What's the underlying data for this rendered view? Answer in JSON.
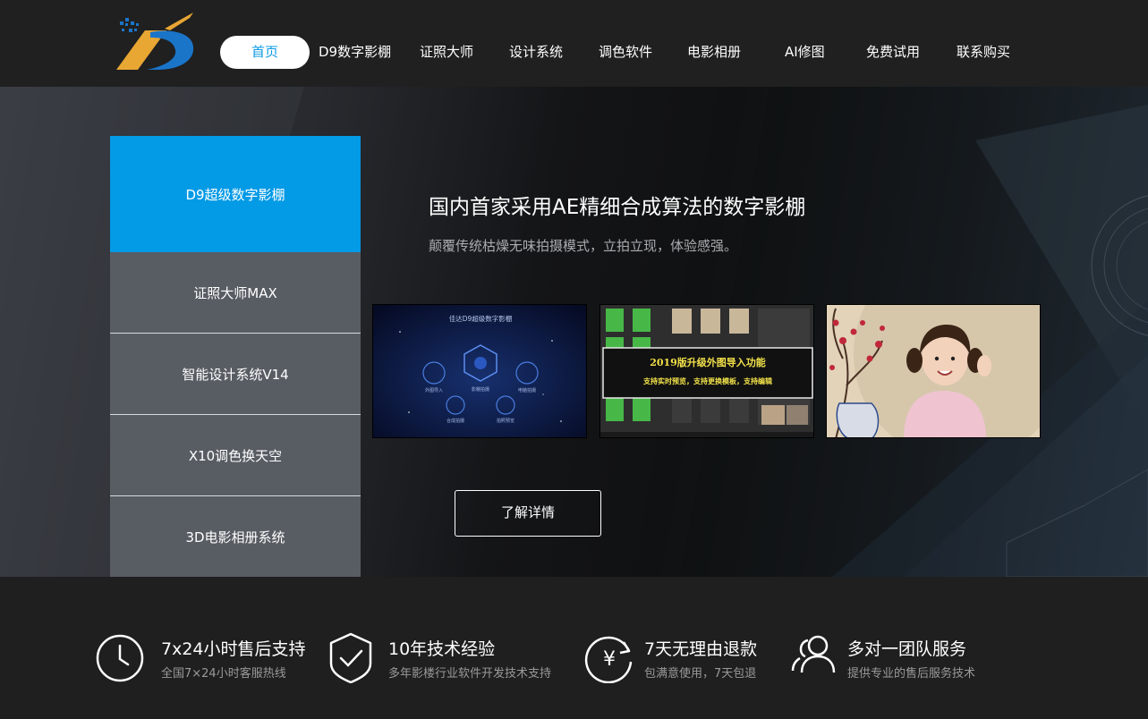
{
  "nav": {
    "items": [
      "首页",
      "D9数字影棚",
      "证照大师",
      "设计系统",
      "调色软件",
      "电影相册",
      "AI修图",
      "免费试用",
      "联系购买"
    ],
    "active_index": 0
  },
  "sidebar": {
    "items": [
      "D9超级数字影棚",
      "证照大师MAX",
      "智能设计系统V14",
      "X10调色换天空",
      "3D电影相册系统"
    ],
    "active_index": 0
  },
  "hero": {
    "title": "国内首家采用AE精细合成算法的数字影棚",
    "subtitle": "颠覆传统枯燥无味拍摄模式，立拍立现，体验感强。",
    "more_button": "了解详情"
  },
  "thumbs": {
    "t1_caption": "佳达D9超级数字影棚",
    "t1_labels": [
      "外图导入",
      "影棚拍摄",
      "电脑拍摄",
      "合成拍摄",
      "拍照预览"
    ],
    "t2_line1": "2019版升级外图导入功能",
    "t2_line2": "支持实时预览，支持更换模板，支持编辑"
  },
  "features": [
    {
      "icon": "clock-icon",
      "title": "7x24小时售后支持",
      "desc": "全国7×24小时客服热线"
    },
    {
      "icon": "shield-check-icon",
      "title": "10年技术经验",
      "desc": "多年影楼行业软件开发技术支持"
    },
    {
      "icon": "yuan-refund-icon",
      "title": "7天无理由退款",
      "desc": "包满意使用，7天包退"
    },
    {
      "icon": "team-icon",
      "title": "多对一团队服务",
      "desc": "提供专业的售后服务技术"
    }
  ],
  "colors": {
    "accent": "#039ae6",
    "header": "#202020",
    "sidebar": "#585c63",
    "logo_gold": "#e8a633",
    "logo_blue": "#1a75c9"
  }
}
